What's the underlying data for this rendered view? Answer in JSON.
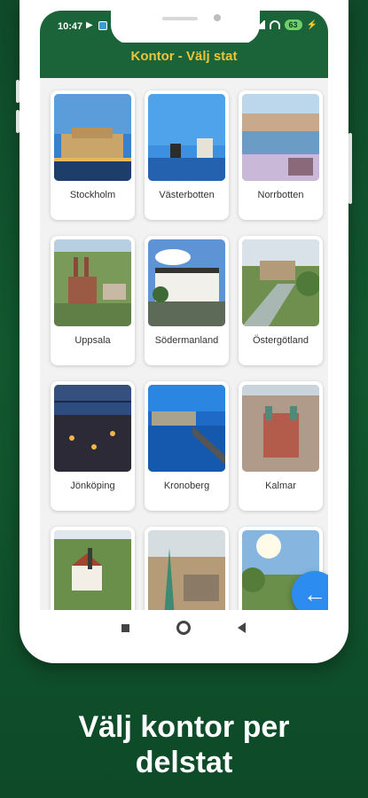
{
  "status": {
    "time": "10:47",
    "battery": "63"
  },
  "appbar": {
    "title": "Kontor - Välj stat"
  },
  "states": [
    {
      "label": "Stockholm",
      "photo": "stockholm-photo"
    },
    {
      "label": "Västerbotten",
      "photo": "vasterbotten-photo"
    },
    {
      "label": "Norrbotten",
      "photo": "norrbotten-photo"
    },
    {
      "label": "Uppsala",
      "photo": "uppsala-photo"
    },
    {
      "label": "Södermanland",
      "photo": "sodermanland-photo"
    },
    {
      "label": "Östergötland",
      "photo": "ostergotland-photo"
    },
    {
      "label": "Jönköping",
      "photo": "jonkoping-photo"
    },
    {
      "label": "Kronoberg",
      "photo": "kronoberg-photo"
    },
    {
      "label": "Kalmar",
      "photo": "kalmar-photo"
    }
  ],
  "fab": {
    "icon": "arrow-left-icon",
    "glyph": "←"
  },
  "caption": {
    "line1": "Välj kontor per",
    "line2": "delstat"
  },
  "colors": {
    "brand_green": "#1b6338",
    "title_yellow": "#e8c53a",
    "fab_blue": "#2d8cf0"
  }
}
